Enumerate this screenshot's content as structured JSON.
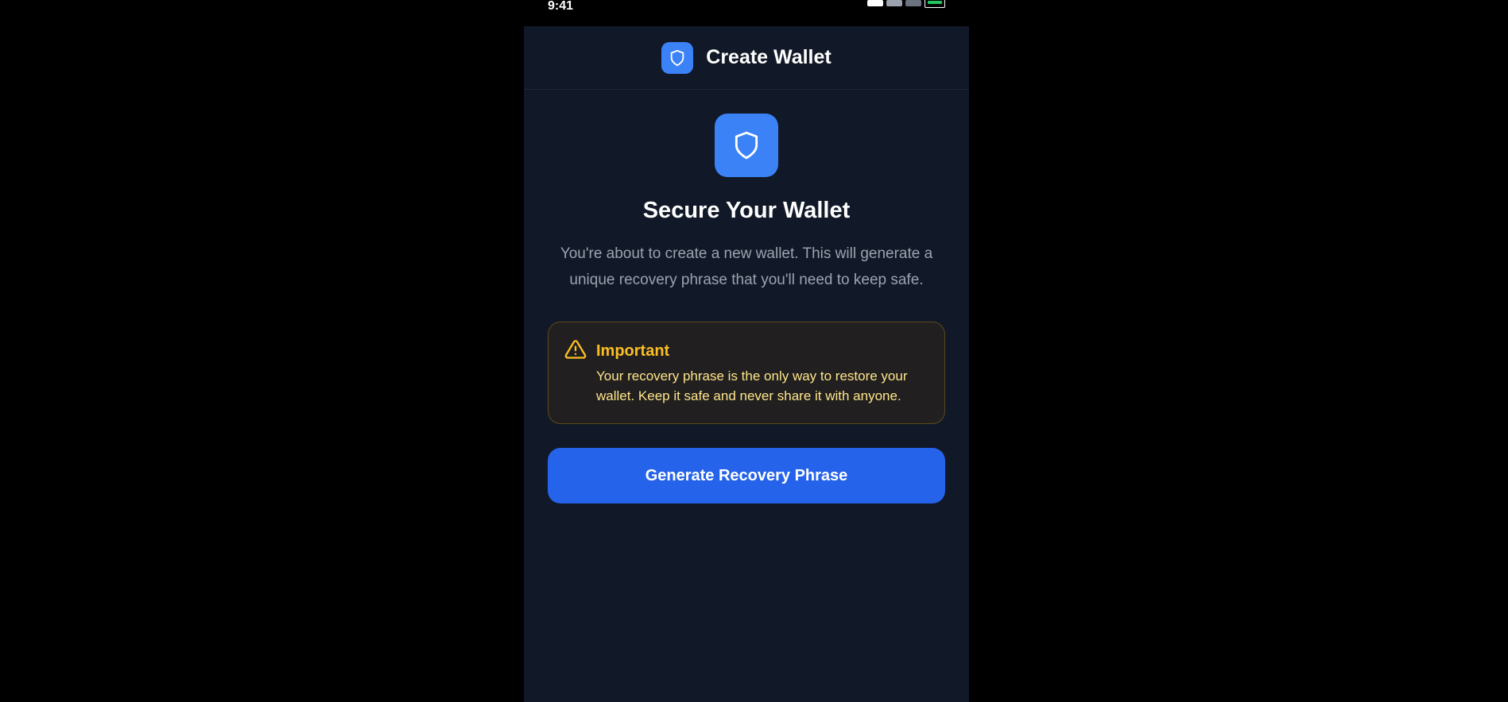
{
  "status_bar": {
    "time": "9:41",
    "icons": [
      "signal-icon",
      "wifi-icon",
      "battery-icon"
    ]
  },
  "header": {
    "title": "Create Wallet",
    "icon": "shield-icon"
  },
  "hero": {
    "icon": "shield-icon",
    "title": "Secure Your Wallet",
    "description": "You're about to create a new wallet. This will generate a unique recovery phrase that you'll need to keep safe."
  },
  "warning": {
    "icon": "warning-triangle-icon",
    "title": "Important",
    "text": "Your recovery phrase is the only way to restore your wallet. Keep it safe and never share it with anyone."
  },
  "actions": {
    "generate_label": "Generate Recovery Phrase"
  },
  "colors": {
    "accent": "#3b82f6",
    "button": "#2563eb",
    "background": "#111827",
    "warning": "#fbbf24"
  }
}
